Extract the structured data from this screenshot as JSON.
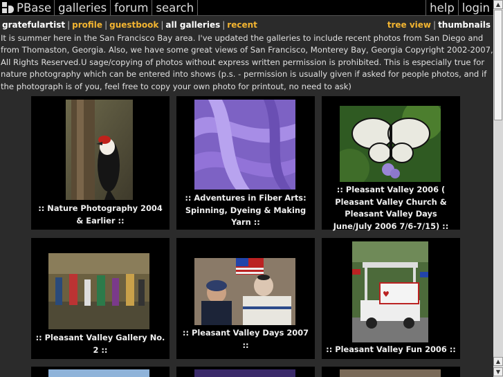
{
  "nav": {
    "logo": "PBase",
    "items": [
      "galleries",
      "forum",
      "search"
    ],
    "right": [
      "help",
      "login"
    ]
  },
  "userbar": {
    "username": "gratefulartist",
    "links": [
      "profile",
      "guestbook"
    ],
    "all_galleries": "all galleries",
    "recent": "recent",
    "tree_view": "tree view",
    "thumbnails": "thumbnails",
    "separator": "|"
  },
  "description": "It is summer here in the San Francisco Bay area. I've updated the galleries to include recent photos from San Diego and from Thomaston, Georgia. Also, we have some great views of San Francisco, Monterey Bay, Georgia Copyright 2002-2007, All Rights Reserved.U sage/copying of photos without express written permission is prohibited. This is especially true for nature photography which can be entered into shows (p.s. - permission is usually given if asked for people photos, and if the photograph is of you, feel free to copy your own photo for printout, no need to ask)",
  "galleries": [
    {
      "caption": ":: Nature Photography 2004 & Earlier ::"
    },
    {
      "caption": ":: Adventures in Fiber Arts: Spinning, Dyeing & Making Yarn ::"
    },
    {
      "caption": ":: Pleasant Valley 2006 ( Pleasant Valley Church & Pleasant Valley Days June/July 2006 7/6-7/15) ::"
    },
    {
      "caption": ":: Pleasant Valley Gallery No. 2 ::"
    },
    {
      "caption": ":: Pleasant Valley Days 2007 ::"
    },
    {
      "caption": ":: Pleasant Valley Fun 2006 ::"
    }
  ],
  "colors": {
    "link": "#f2b431",
    "background": "#2b2b2b",
    "card": "#000000"
  }
}
